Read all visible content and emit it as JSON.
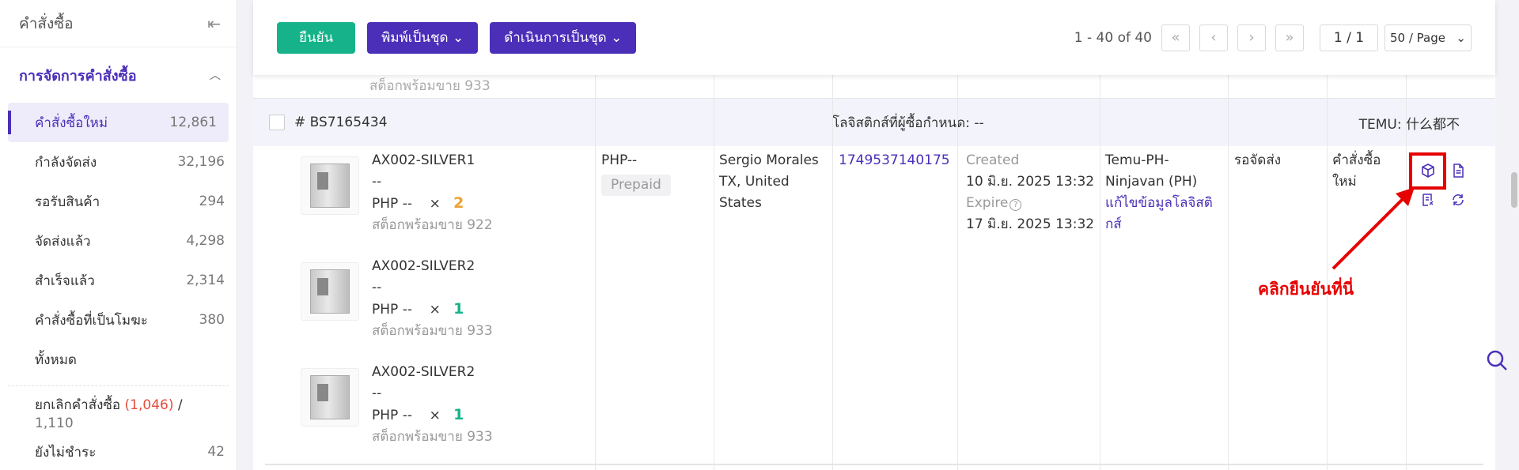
{
  "sidebar": {
    "title": "คำสั่งซื้อ",
    "group_label": "การจัดการคำสั่งซื้อ",
    "items": [
      {
        "label": "คำสั่งซื้อใหม่",
        "count": "12,861"
      },
      {
        "label": "กำลังจัดส่ง",
        "count": "32,196"
      },
      {
        "label": "รอรับสินค้า",
        "count": "294"
      },
      {
        "label": "จัดส่งแล้ว",
        "count": "4,298"
      },
      {
        "label": "สำเร็จแล้ว",
        "count": "2,314"
      },
      {
        "label": "คำสั่งซื้อที่เป็นโมฆะ",
        "count": "380"
      },
      {
        "label": "ทั้งหมด",
        "count": ""
      }
    ],
    "cancel": {
      "label": "ยกเลิกคำสั่งซื้อ",
      "red_count": "(1,046)",
      "sep": "/",
      "total": "1,110"
    },
    "unpaid": {
      "label": "ยังไม่ชำระ",
      "count": "42"
    }
  },
  "toolbar": {
    "confirm_label": "ยืนยัน",
    "print_batch_label": "พิมพ์เป็นชุด",
    "process_batch_label": "ดำเนินการเป็นชุด",
    "range_text": "1 - 40 of 40",
    "page_text": "1 / 1",
    "page_size": "50 / Page"
  },
  "prev_stock": "สต็อกพร้อมขาย 933",
  "order": {
    "id": "# BS7165434",
    "logistics_text": "โลจิสติกส์ที่ผู้ซื้อกำหนด: --",
    "platform": "TEMU: 什么都不",
    "price": "PHP--",
    "payment": "Prepaid",
    "buyer": [
      "Sergio Morales",
      "TX, United",
      "States"
    ],
    "tracking": "1749537140175",
    "created_label": "Created",
    "created": "10 มิ.ย. 2025 13:32",
    "expire_label": "Expire",
    "expire": "17 มิ.ย. 2025 13:32",
    "carrier": [
      "Temu-PH-",
      "Ninjavan (PH)"
    ],
    "edit_logistics": [
      "แก้ไขข้อมูลโลจิสติ",
      "กส์"
    ],
    "fulfil_status": "รอจัดส่ง",
    "order_status": [
      "คำสั่งซื้อ",
      "ใหม่"
    ],
    "products": [
      {
        "sku": "AX002-SILVER1",
        "sub": "--",
        "price": "PHP --",
        "times": "×",
        "qty": "2",
        "stock": "สต็อกพร้อมขาย 922"
      },
      {
        "sku": "AX002-SILVER2",
        "sub": "--",
        "price": "PHP --",
        "times": "×",
        "qty": "1",
        "stock": "สต็อกพร้อมขาย 933"
      },
      {
        "sku": "AX002-SILVER2",
        "sub": "--",
        "price": "PHP --",
        "times": "×",
        "qty": "1",
        "stock": "สต็อกพร้อมขาย 933"
      }
    ]
  },
  "annotation": "คลิกยืนยันที่นี่",
  "colors": {
    "accent": "#4b2fb8",
    "confirm": "#16b38a",
    "highlight": "#e60000"
  }
}
